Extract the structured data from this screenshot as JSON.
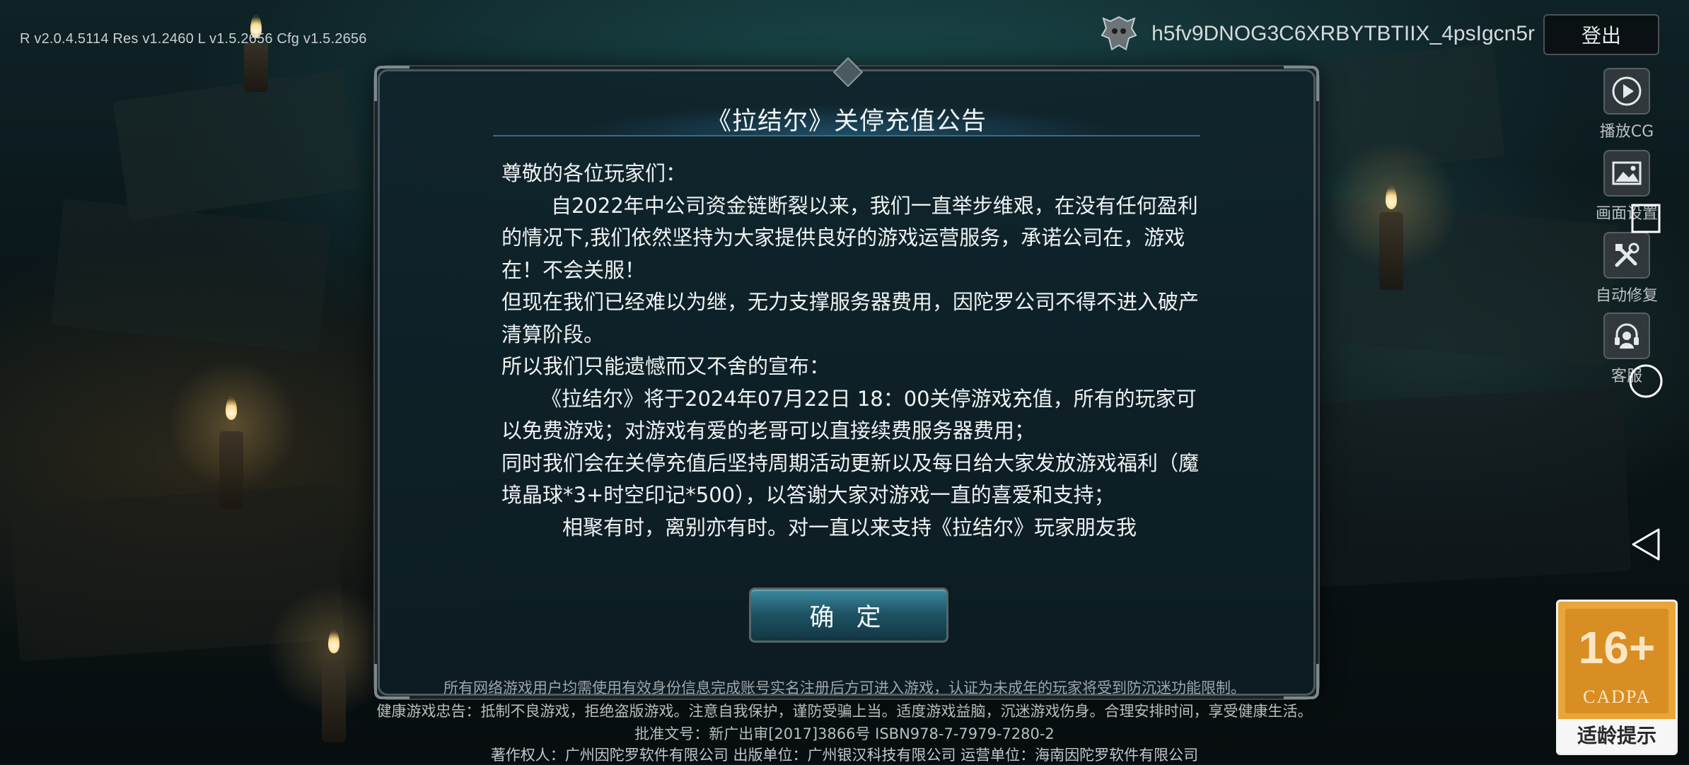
{
  "top_bar": {
    "version": "R v2.0.4.5114  Res v1.2460  L v1.5.2656  Cfg v1.5.2656",
    "account_id": "h5fv9DNOG3C6XRBYTBTIIX_4psIgcn5r",
    "logout_label": "登出"
  },
  "side_tools": [
    {
      "label": "播放CG",
      "icon": "play-icon"
    },
    {
      "label": "画面设置",
      "icon": "image-icon"
    },
    {
      "label": "自动修复",
      "icon": "repair-tools-icon"
    },
    {
      "label": "客服",
      "icon": "headset-icon"
    }
  ],
  "dialog": {
    "title": "《拉结尔》关停充值公告",
    "paragraphs": [
      "尊敬的各位玩家们：",
      "自2022年中公司资金链断裂以来，我们一直举步维艰，在没有任何盈利的情况下,我们依然坚持为大家提供良好的游戏运营服务，承诺公司在，游戏在！不会关服！",
      "但现在我们已经难以为继，无力支撑服务器费用，因陀罗公司不得不进入破产清算阶段。",
      "所以我们只能遗憾而又不舍的宣布：",
      "《拉结尔》将于2024年07月22日 18：00关停游戏充值，所有的玩家可以免费游戏；对游戏有爱的老哥可以直接续费服务器费用；",
      "同时我们会在关停充值后坚持周期活动更新以及每日给大家发放游戏福利（魔境晶球*3+时空印记*500），以答谢大家对游戏一直的喜爱和支持；",
      "相聚有时，离别亦有时。对一直以来支持《拉结尔》玩家朋友我"
    ],
    "confirm_label": "确 定"
  },
  "footer": {
    "line1": "所有网络游戏用户均需使用有效身份信息完成账号实名注册后方可进入游戏，认证为未成年的玩家将受到防沉迷功能限制。",
    "line2": "健康游戏忠告：抵制不良游戏，拒绝盗版游戏。注意自我保护，谨防受骗上当。适度游戏益脑，沉迷游戏伤身。合理安排时间，享受健康生活。",
    "line3": "批准文号：新广出审[2017]3866号  ISBN978-7-7979-7280-2",
    "line4": "著作权人：广州因陀罗软件有限公司  出版单位：广州银汉科技有限公司  运营单位：海南因陀罗软件有限公司"
  },
  "age_rating": {
    "rating": "16+",
    "org": "CADPA",
    "tip": "适龄提示"
  },
  "colors": {
    "dialog_bg": "#10242c",
    "title_accent": "#5aaad2",
    "confirm_button": "#1f5566",
    "age_badge": "#e9a53a"
  }
}
